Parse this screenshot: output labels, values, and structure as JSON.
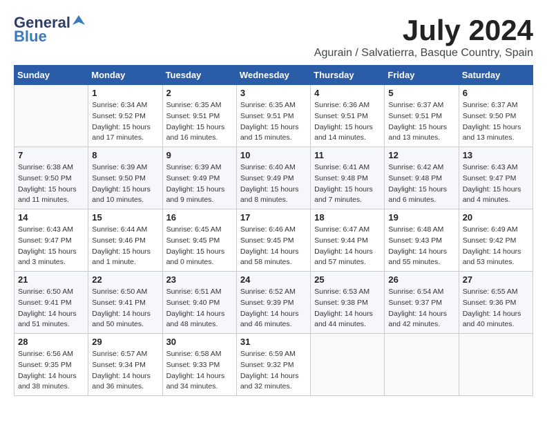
{
  "header": {
    "logo_general": "General",
    "logo_blue": "Blue",
    "title": "July 2024",
    "location": "Agurain / Salvatierra, Basque Country, Spain"
  },
  "calendar": {
    "weekdays": [
      "Sunday",
      "Monday",
      "Tuesday",
      "Wednesday",
      "Thursday",
      "Friday",
      "Saturday"
    ],
    "weeks": [
      [
        {
          "day": "",
          "info": ""
        },
        {
          "day": "1",
          "info": "Sunrise: 6:34 AM\nSunset: 9:52 PM\nDaylight: 15 hours\nand 17 minutes."
        },
        {
          "day": "2",
          "info": "Sunrise: 6:35 AM\nSunset: 9:51 PM\nDaylight: 15 hours\nand 16 minutes."
        },
        {
          "day": "3",
          "info": "Sunrise: 6:35 AM\nSunset: 9:51 PM\nDaylight: 15 hours\nand 15 minutes."
        },
        {
          "day": "4",
          "info": "Sunrise: 6:36 AM\nSunset: 9:51 PM\nDaylight: 15 hours\nand 14 minutes."
        },
        {
          "day": "5",
          "info": "Sunrise: 6:37 AM\nSunset: 9:51 PM\nDaylight: 15 hours\nand 13 minutes."
        },
        {
          "day": "6",
          "info": "Sunrise: 6:37 AM\nSunset: 9:50 PM\nDaylight: 15 hours\nand 13 minutes."
        }
      ],
      [
        {
          "day": "7",
          "info": "Sunrise: 6:38 AM\nSunset: 9:50 PM\nDaylight: 15 hours\nand 11 minutes."
        },
        {
          "day": "8",
          "info": "Sunrise: 6:39 AM\nSunset: 9:50 PM\nDaylight: 15 hours\nand 10 minutes."
        },
        {
          "day": "9",
          "info": "Sunrise: 6:39 AM\nSunset: 9:49 PM\nDaylight: 15 hours\nand 9 minutes."
        },
        {
          "day": "10",
          "info": "Sunrise: 6:40 AM\nSunset: 9:49 PM\nDaylight: 15 hours\nand 8 minutes."
        },
        {
          "day": "11",
          "info": "Sunrise: 6:41 AM\nSunset: 9:48 PM\nDaylight: 15 hours\nand 7 minutes."
        },
        {
          "day": "12",
          "info": "Sunrise: 6:42 AM\nSunset: 9:48 PM\nDaylight: 15 hours\nand 6 minutes."
        },
        {
          "day": "13",
          "info": "Sunrise: 6:43 AM\nSunset: 9:47 PM\nDaylight: 15 hours\nand 4 minutes."
        }
      ],
      [
        {
          "day": "14",
          "info": "Sunrise: 6:43 AM\nSunset: 9:47 PM\nDaylight: 15 hours\nand 3 minutes."
        },
        {
          "day": "15",
          "info": "Sunrise: 6:44 AM\nSunset: 9:46 PM\nDaylight: 15 hours\nand 1 minute."
        },
        {
          "day": "16",
          "info": "Sunrise: 6:45 AM\nSunset: 9:45 PM\nDaylight: 15 hours\nand 0 minutes."
        },
        {
          "day": "17",
          "info": "Sunrise: 6:46 AM\nSunset: 9:45 PM\nDaylight: 14 hours\nand 58 minutes."
        },
        {
          "day": "18",
          "info": "Sunrise: 6:47 AM\nSunset: 9:44 PM\nDaylight: 14 hours\nand 57 minutes."
        },
        {
          "day": "19",
          "info": "Sunrise: 6:48 AM\nSunset: 9:43 PM\nDaylight: 14 hours\nand 55 minutes."
        },
        {
          "day": "20",
          "info": "Sunrise: 6:49 AM\nSunset: 9:42 PM\nDaylight: 14 hours\nand 53 minutes."
        }
      ],
      [
        {
          "day": "21",
          "info": "Sunrise: 6:50 AM\nSunset: 9:41 PM\nDaylight: 14 hours\nand 51 minutes."
        },
        {
          "day": "22",
          "info": "Sunrise: 6:50 AM\nSunset: 9:41 PM\nDaylight: 14 hours\nand 50 minutes."
        },
        {
          "day": "23",
          "info": "Sunrise: 6:51 AM\nSunset: 9:40 PM\nDaylight: 14 hours\nand 48 minutes."
        },
        {
          "day": "24",
          "info": "Sunrise: 6:52 AM\nSunset: 9:39 PM\nDaylight: 14 hours\nand 46 minutes."
        },
        {
          "day": "25",
          "info": "Sunrise: 6:53 AM\nSunset: 9:38 PM\nDaylight: 14 hours\nand 44 minutes."
        },
        {
          "day": "26",
          "info": "Sunrise: 6:54 AM\nSunset: 9:37 PM\nDaylight: 14 hours\nand 42 minutes."
        },
        {
          "day": "27",
          "info": "Sunrise: 6:55 AM\nSunset: 9:36 PM\nDaylight: 14 hours\nand 40 minutes."
        }
      ],
      [
        {
          "day": "28",
          "info": "Sunrise: 6:56 AM\nSunset: 9:35 PM\nDaylight: 14 hours\nand 38 minutes."
        },
        {
          "day": "29",
          "info": "Sunrise: 6:57 AM\nSunset: 9:34 PM\nDaylight: 14 hours\nand 36 minutes."
        },
        {
          "day": "30",
          "info": "Sunrise: 6:58 AM\nSunset: 9:33 PM\nDaylight: 14 hours\nand 34 minutes."
        },
        {
          "day": "31",
          "info": "Sunrise: 6:59 AM\nSunset: 9:32 PM\nDaylight: 14 hours\nand 32 minutes."
        },
        {
          "day": "",
          "info": ""
        },
        {
          "day": "",
          "info": ""
        },
        {
          "day": "",
          "info": ""
        }
      ]
    ]
  }
}
